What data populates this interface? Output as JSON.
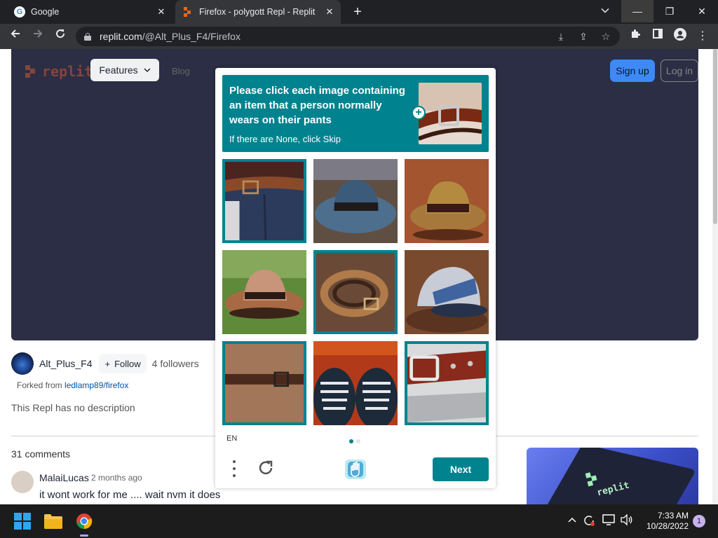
{
  "browser": {
    "tabs": [
      {
        "title": "Google",
        "active": false
      },
      {
        "title": "Firefox - polygott Repl - Replit",
        "active": true
      }
    ],
    "url_host": "replit.com",
    "url_path": "/@Alt_Plus_F4/Firefox"
  },
  "page": {
    "nav": {
      "logo_text": "replit",
      "features_label": "Features",
      "blog_label": "Blog",
      "signup_label": "Sign up",
      "login_label": "Log in"
    },
    "author": {
      "name": "Alt_Plus_F4",
      "follow_label": "Follow",
      "followers": "4 followers",
      "forked_prefix": "Forked from",
      "forked_link": "ledlamp89/firefox"
    },
    "description": "This Repl has no description",
    "comments_count": "31 comments",
    "comment": {
      "user": "MalaiLucas",
      "time": "2 months ago",
      "text": "it wont work for me .... wait nvm it does"
    },
    "promo_text": "replit"
  },
  "captcha": {
    "prompt": "Please click each image containing an item that a person normally wears on their pants",
    "sub_prompt": "If there are None, click Skip",
    "language": "EN",
    "next_label": "Next",
    "accent_color": "#00838f",
    "tiles": [
      {
        "subject": "belt on jeans",
        "selected": true
      },
      {
        "subject": "blue fedora hat",
        "selected": false
      },
      {
        "subject": "fedora hat",
        "selected": false
      },
      {
        "subject": "cowboy hat on grass",
        "selected": false
      },
      {
        "subject": "coiled belt",
        "selected": true
      },
      {
        "subject": "baseball cap",
        "selected": false
      },
      {
        "subject": "belt",
        "selected": true
      },
      {
        "subject": "sneakers",
        "selected": false
      },
      {
        "subject": "belt buckle",
        "selected": true
      }
    ]
  },
  "taskbar": {
    "time": "7:33 AM",
    "date": "10/28/2022",
    "notification_count": "1"
  }
}
